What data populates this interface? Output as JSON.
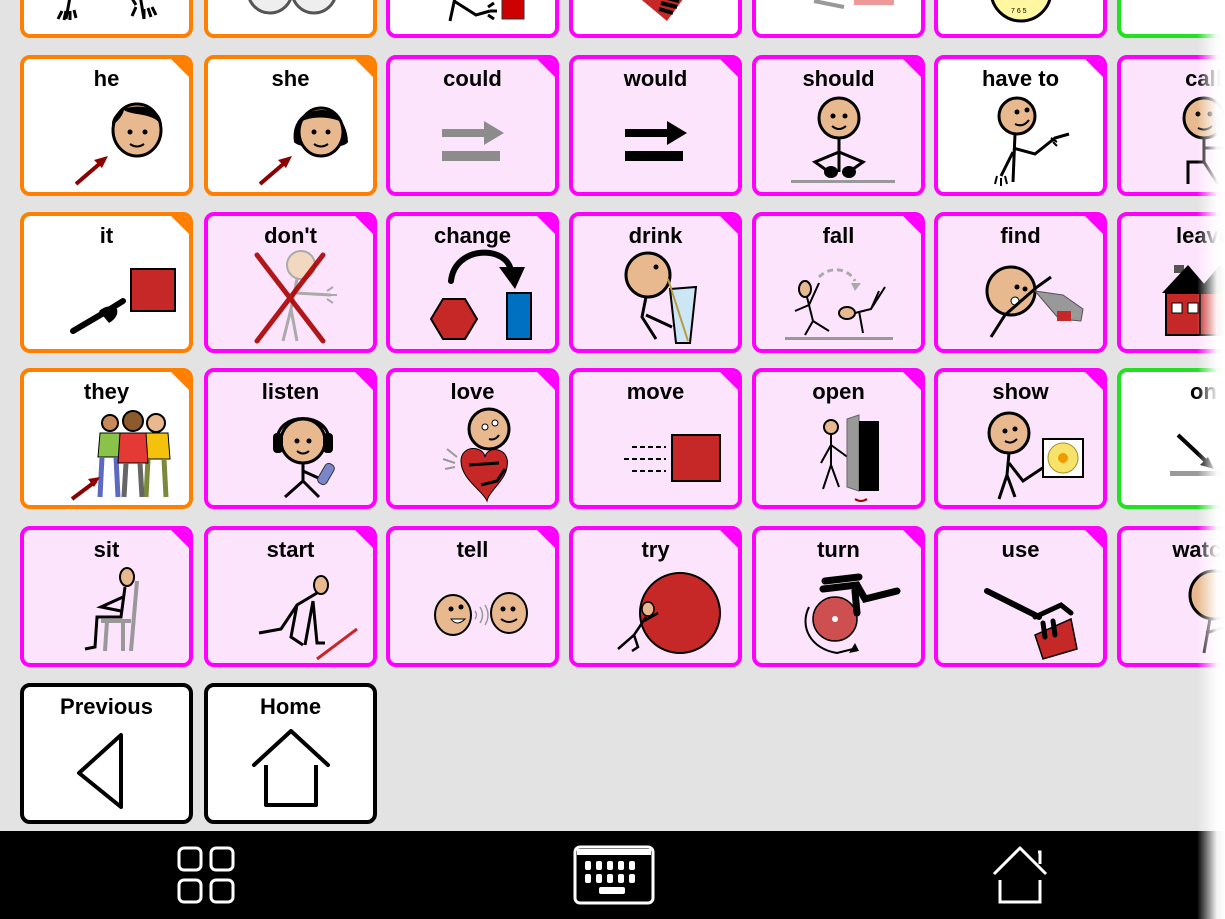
{
  "colors": {
    "background": "#e3e3e3",
    "pronoun_border": "#ff8000",
    "verb_border": "#ff00ff",
    "verb_fill": "#fde4fd",
    "preposition_border": "#22e022",
    "nav_border": "#000000",
    "bottom_bar": "#000000"
  },
  "top_partial_row": [
    {
      "label": "",
      "category": "pronoun",
      "icon": "hands-symbol"
    },
    {
      "label": "",
      "category": "pronoun",
      "icon": "faces-symbol"
    },
    {
      "label": "",
      "category": "verb",
      "icon": "hand-reach-symbol"
    },
    {
      "label": "",
      "category": "verb",
      "icon": "hand-red-shape-symbol"
    },
    {
      "label": "",
      "category": "verb",
      "icon": "arrow-symbol"
    },
    {
      "label": "",
      "category": "verb",
      "icon": "clock-symbol"
    },
    {
      "label": "",
      "category": "preposition",
      "icon": "stick-symbol"
    }
  ],
  "rows": [
    [
      {
        "label": "he",
        "category": "pronoun",
        "icon": "he-boy-face-symbol"
      },
      {
        "label": "she",
        "category": "pronoun",
        "icon": "she-girl-face-symbol"
      },
      {
        "label": "could",
        "category": "verb",
        "icon": "could-gray-arrow-symbol"
      },
      {
        "label": "would",
        "category": "verb",
        "icon": "would-black-arrow-symbol"
      },
      {
        "label": "should",
        "category": "verb",
        "icon": "should-person-symbol"
      },
      {
        "label": "have to",
        "category": "verb",
        "icon": "have-to-pointing-person-symbol"
      },
      {
        "label": "call",
        "category": "verb",
        "icon": "call-person-phone-symbol"
      }
    ],
    [
      {
        "label": "it",
        "category": "pronoun",
        "icon": "it-pointing-square-symbol"
      },
      {
        "label": "don't",
        "category": "verb",
        "icon": "dont-crossed-person-symbol"
      },
      {
        "label": "change",
        "category": "verb",
        "icon": "change-shapes-symbol"
      },
      {
        "label": "drink",
        "category": "verb",
        "icon": "drink-glass-symbol"
      },
      {
        "label": "fall",
        "category": "verb",
        "icon": "fall-people-symbol"
      },
      {
        "label": "find",
        "category": "verb",
        "icon": "find-person-symbol"
      },
      {
        "label": "leave",
        "category": "verb",
        "icon": "leave-house-symbol"
      }
    ],
    [
      {
        "label": "they",
        "category": "pronoun",
        "icon": "they-group-symbol"
      },
      {
        "label": "listen",
        "category": "verb",
        "icon": "listen-headphones-symbol"
      },
      {
        "label": "love",
        "category": "verb",
        "icon": "love-heart-symbol"
      },
      {
        "label": "move",
        "category": "verb",
        "icon": "move-square-symbol"
      },
      {
        "label": "open",
        "category": "verb",
        "icon": "open-door-symbol"
      },
      {
        "label": "show",
        "category": "verb",
        "icon": "show-flower-picture-symbol"
      },
      {
        "label": "on",
        "category": "preposition",
        "icon": "on-arrow-block-symbol"
      }
    ],
    [
      {
        "label": "sit",
        "category": "verb",
        "icon": "sit-chair-symbol"
      },
      {
        "label": "start",
        "category": "verb",
        "icon": "start-runner-symbol"
      },
      {
        "label": "tell",
        "category": "verb",
        "icon": "tell-faces-symbol"
      },
      {
        "label": "try",
        "category": "verb",
        "icon": "try-push-ball-symbol"
      },
      {
        "label": "turn",
        "category": "verb",
        "icon": "turn-knob-symbol"
      },
      {
        "label": "use",
        "category": "verb",
        "icon": "use-hand-tool-symbol"
      },
      {
        "label": "watch",
        "category": "verb",
        "icon": "watch-person-symbol"
      }
    ]
  ],
  "nav": {
    "previous_label": "Previous",
    "home_label": "Home"
  },
  "bottom_bar": {
    "items": [
      {
        "name": "grid-view",
        "icon": "grid-icon"
      },
      {
        "name": "keyboard",
        "icon": "keyboard-icon"
      },
      {
        "name": "home",
        "icon": "home-icon"
      }
    ]
  }
}
